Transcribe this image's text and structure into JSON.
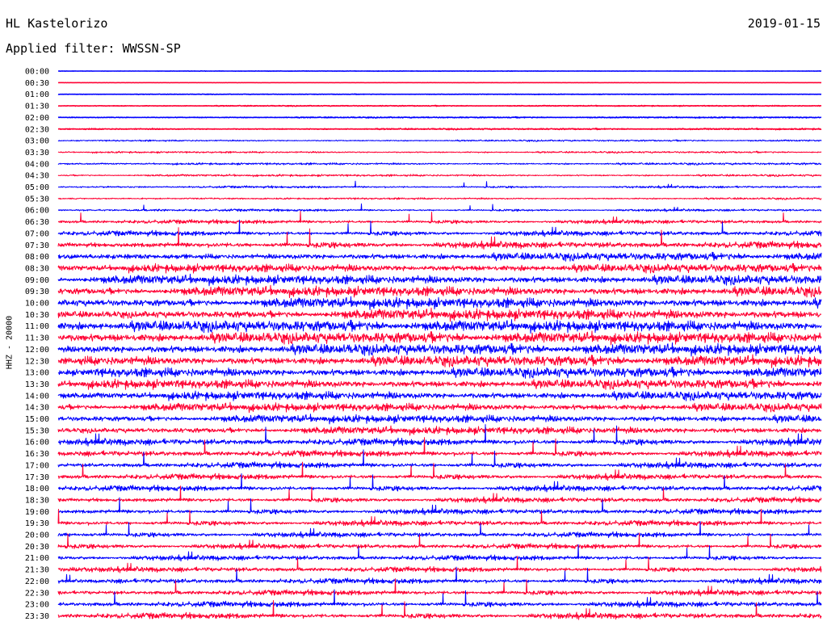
{
  "header": {
    "station": "HL Kastelorizo",
    "date": "2019-01-15",
    "filter": "Applied filter: WWSSN-SP"
  },
  "chart_data": {
    "type": "helicorder",
    "title": "HL Kastelorizo",
    "date": "2019-01-15",
    "filter": "WWSSN-SP",
    "ylabel": "HHZ - 20000",
    "row_labels": [
      "00:00",
      "00:30",
      "01:00",
      "01:30",
      "02:00",
      "02:30",
      "03:00",
      "03:30",
      "04:00",
      "04:30",
      "05:00",
      "05:30",
      "06:00",
      "06:30",
      "07:00",
      "07:30",
      "08:00",
      "08:30",
      "09:00",
      "09:30",
      "10:00",
      "10:30",
      "11:00",
      "11:30",
      "12:00",
      "12:30",
      "13:00",
      "13:30",
      "14:00",
      "14:30",
      "15:00",
      "15:30",
      "16:00",
      "16:30",
      "17:00",
      "17:30",
      "18:00",
      "18:30",
      "19:00",
      "19:30",
      "20:00",
      "20:30",
      "21:00",
      "21:30",
      "22:00",
      "22:30",
      "23:00",
      "23:30"
    ],
    "series_colors": [
      "#0000ff",
      "#ff0033"
    ],
    "relative_amplitude": [
      0.06,
      0.04,
      0.1,
      0.15,
      0.18,
      0.22,
      0.3,
      0.33,
      0.4,
      0.38,
      0.42,
      0.35,
      0.45,
      0.75,
      0.95,
      1.25,
      1.4,
      1.5,
      1.65,
      1.75,
      1.85,
      1.9,
      1.95,
      1.95,
      1.9,
      1.85,
      1.75,
      1.65,
      1.55,
      1.45,
      1.4,
      1.35,
      1.25,
      1.15,
      1.1,
      1.05,
      1.05,
      1.0,
      1.0,
      1.0,
      0.95,
      0.95,
      0.95,
      0.95,
      1.0,
      1.0,
      1.05,
      1.1
    ],
    "grid": false
  }
}
